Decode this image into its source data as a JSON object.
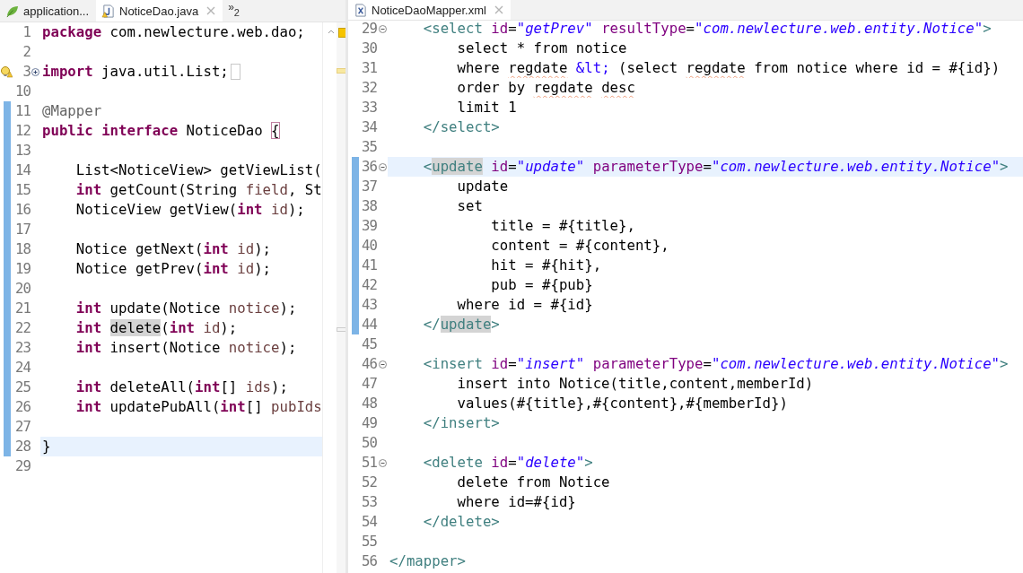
{
  "left_editor": {
    "tabs": [
      {
        "kind": "spring",
        "label": "application...",
        "selected": false,
        "closable": false
      },
      {
        "kind": "java",
        "label": "NoticeDao.java",
        "selected": true,
        "closable": true
      }
    ],
    "overflow": {
      "glyph": "»",
      "count": "2"
    },
    "lines": [
      {
        "number": "1",
        "changed": false,
        "current": false,
        "tokens": [
          {
            "kind": "kw",
            "text": "package"
          },
          {
            "kind": "plain",
            "text": " com.newlecture.web.dao;"
          }
        ]
      },
      {
        "number": "2",
        "changed": false,
        "current": false
      },
      {
        "number": "3",
        "changed": false,
        "current": false,
        "expanded": false,
        "warning": true,
        "folded_marker": true,
        "tokens": [
          {
            "kind": "kw",
            "text": "import"
          },
          {
            "kind": "plain",
            "text": " java.util.List;"
          }
        ]
      },
      {
        "number": "10",
        "changed": false,
        "current": false
      },
      {
        "number": "11",
        "changed": true,
        "current": false,
        "tokens": [
          {
            "kind": "ann",
            "text": "@Mapper"
          }
        ]
      },
      {
        "number": "12",
        "changed": true,
        "current": false,
        "tokens": [
          {
            "kind": "kw",
            "text": "public "
          },
          {
            "kind": "kw",
            "text": "interface"
          },
          {
            "kind": "plain",
            "text": " NoticeDao "
          },
          {
            "kind": "bracket",
            "text": "{"
          }
        ]
      },
      {
        "number": "13",
        "changed": true,
        "current": false
      },
      {
        "number": "14",
        "changed": true,
        "current": false,
        "tokens": [
          {
            "kind": "plain",
            "text": "    List<NoticeView> getViewList("
          }
        ]
      },
      {
        "number": "15",
        "changed": true,
        "current": false,
        "tokens": [
          {
            "kind": "kw",
            "text": "    int"
          },
          {
            "kind": "plain",
            "text": " getCount(String "
          },
          {
            "kind": "param",
            "text": "field"
          },
          {
            "kind": "plain",
            "text": ", St"
          }
        ]
      },
      {
        "number": "16",
        "changed": true,
        "current": false,
        "tokens": [
          {
            "kind": "plain",
            "text": "    NoticeView getView("
          },
          {
            "kind": "kw",
            "text": "int "
          },
          {
            "kind": "param",
            "text": "id"
          },
          {
            "kind": "plain",
            "text": ");"
          }
        ]
      },
      {
        "number": "17",
        "changed": true,
        "current": false
      },
      {
        "number": "18",
        "changed": true,
        "current": false,
        "tokens": [
          {
            "kind": "plain",
            "text": "    Notice getNext("
          },
          {
            "kind": "kw",
            "text": "int "
          },
          {
            "kind": "param",
            "text": "id"
          },
          {
            "kind": "plain",
            "text": ");"
          }
        ]
      },
      {
        "number": "19",
        "changed": true,
        "current": false,
        "tokens": [
          {
            "kind": "plain",
            "text": "    Notice getPrev("
          },
          {
            "kind": "kw",
            "text": "int "
          },
          {
            "kind": "param",
            "text": "id"
          },
          {
            "kind": "plain",
            "text": ");"
          }
        ]
      },
      {
        "number": "20",
        "changed": true,
        "current": false
      },
      {
        "number": "21",
        "changed": true,
        "current": false,
        "tokens": [
          {
            "kind": "kw",
            "text": "    int"
          },
          {
            "kind": "plain",
            "text": " update(Notice "
          },
          {
            "kind": "param",
            "text": "notice"
          },
          {
            "kind": "plain",
            "text": ");"
          }
        ]
      },
      {
        "number": "22",
        "changed": true,
        "current": false,
        "tokens": [
          {
            "kind": "kw",
            "text": "    int "
          },
          {
            "kind": "occurrence",
            "text": "delete"
          },
          {
            "kind": "plain",
            "text": "("
          },
          {
            "kind": "kw",
            "text": "int "
          },
          {
            "kind": "param",
            "text": "id"
          },
          {
            "kind": "plain",
            "text": ");"
          }
        ]
      },
      {
        "number": "23",
        "changed": true,
        "current": false,
        "tokens": [
          {
            "kind": "kw",
            "text": "    int"
          },
          {
            "kind": "plain",
            "text": " insert(Notice "
          },
          {
            "kind": "param",
            "text": "notice"
          },
          {
            "kind": "plain",
            "text": ");"
          }
        ]
      },
      {
        "number": "24",
        "changed": true,
        "current": false
      },
      {
        "number": "25",
        "changed": true,
        "current": false,
        "tokens": [
          {
            "kind": "kw",
            "text": "    int"
          },
          {
            "kind": "plain",
            "text": " deleteAll("
          },
          {
            "kind": "kw",
            "text": "int"
          },
          {
            "kind": "plain",
            "text": "[] "
          },
          {
            "kind": "param",
            "text": "ids"
          },
          {
            "kind": "plain",
            "text": ");"
          }
        ]
      },
      {
        "number": "26",
        "changed": true,
        "current": false,
        "tokens": [
          {
            "kind": "kw",
            "text": "    int"
          },
          {
            "kind": "plain",
            "text": " updatePubAll("
          },
          {
            "kind": "kw",
            "text": "int"
          },
          {
            "kind": "plain",
            "text": "[] "
          },
          {
            "kind": "param",
            "text": "pubIds"
          }
        ]
      },
      {
        "number": "27",
        "changed": true,
        "current": false
      },
      {
        "number": "28",
        "changed": true,
        "current": true,
        "tokens": [
          {
            "kind": "plain",
            "text": "}"
          }
        ]
      },
      {
        "number": "29",
        "changed": false,
        "current": false
      }
    ]
  },
  "right_editor": {
    "tabs": [
      {
        "kind": "xml",
        "label": "NoticeDaoMapper.xml",
        "selected": true,
        "closable": true
      }
    ],
    "lines": [
      {
        "number": "29",
        "changed": false,
        "current": false,
        "expanded": true,
        "tokens": [
          {
            "kind": "tag",
            "text": "    <select "
          },
          {
            "kind": "attr",
            "text": "id"
          },
          {
            "kind": "plain",
            "text": "="
          },
          {
            "kind": "str",
            "text": "\"getPrev\" "
          },
          {
            "kind": "attr",
            "text": "resultType"
          },
          {
            "kind": "plain",
            "text": "="
          },
          {
            "kind": "str",
            "text": "\"com.newlecture.web.entity.Notice\""
          },
          {
            "kind": "tag",
            "text": ">"
          }
        ]
      },
      {
        "number": "30",
        "changed": false,
        "current": false,
        "tokens": [
          {
            "kind": "plain",
            "text": "        select * from notice"
          }
        ]
      },
      {
        "number": "31",
        "changed": false,
        "current": false,
        "tokens": [
          {
            "kind": "plain",
            "text": "        where "
          },
          {
            "kind": "flagged",
            "text": "regdate"
          },
          {
            "kind": "ent",
            "text": " &lt;"
          },
          {
            "kind": "plain",
            "text": " (select "
          },
          {
            "kind": "flagged",
            "text": "regdate"
          },
          {
            "kind": "plain",
            "text": " from notice where id = #{id})"
          }
        ]
      },
      {
        "number": "32",
        "changed": false,
        "current": false,
        "tokens": [
          {
            "kind": "plain",
            "text": "        order by "
          },
          {
            "kind": "flagged",
            "text": "regdate"
          },
          {
            "kind": "flagged",
            "text": " desc"
          }
        ]
      },
      {
        "number": "33",
        "changed": false,
        "current": false,
        "tokens": [
          {
            "kind": "plain",
            "text": "        limit 1"
          }
        ]
      },
      {
        "number": "34",
        "changed": false,
        "current": false,
        "tokens": [
          {
            "kind": "tag",
            "text": "    </select>"
          }
        ]
      },
      {
        "number": "35",
        "changed": false,
        "current": false
      },
      {
        "number": "36",
        "changed": true,
        "current": true,
        "expanded": true,
        "tokens": [
          {
            "kind": "tag",
            "text": "    <"
          },
          {
            "kind": "tagmatch",
            "text": "update"
          },
          {
            "kind": "attr",
            "text": " id"
          },
          {
            "kind": "plain",
            "text": "="
          },
          {
            "kind": "str",
            "text": "\"update\" "
          },
          {
            "kind": "attr",
            "text": "parameterType"
          },
          {
            "kind": "plain",
            "text": "="
          },
          {
            "kind": "str",
            "text": "\"com.newlecture.web.entity.Notice\""
          },
          {
            "kind": "tag",
            "text": ">"
          }
        ]
      },
      {
        "number": "37",
        "changed": true,
        "current": false,
        "tokens": [
          {
            "kind": "plain",
            "text": "        update"
          }
        ]
      },
      {
        "number": "38",
        "changed": true,
        "current": false,
        "tokens": [
          {
            "kind": "plain",
            "text": "        set"
          }
        ]
      },
      {
        "number": "39",
        "changed": true,
        "current": false,
        "tokens": [
          {
            "kind": "plain",
            "text": "            title = #{title},"
          }
        ]
      },
      {
        "number": "40",
        "changed": true,
        "current": false,
        "tokens": [
          {
            "kind": "plain",
            "text": "            content = #{content},"
          }
        ]
      },
      {
        "number": "41",
        "changed": true,
        "current": false,
        "tokens": [
          {
            "kind": "plain",
            "text": "            hit = #{hit},"
          }
        ]
      },
      {
        "number": "42",
        "changed": true,
        "current": false,
        "tokens": [
          {
            "kind": "plain",
            "text": "            pub = #{pub}"
          }
        ]
      },
      {
        "number": "43",
        "changed": true,
        "current": false,
        "tokens": [
          {
            "kind": "plain",
            "text": "        where id = #{id}"
          }
        ]
      },
      {
        "number": "44",
        "changed": true,
        "current": false,
        "tokens": [
          {
            "kind": "tag",
            "text": "    </"
          },
          {
            "kind": "tagmatch",
            "text": "update"
          },
          {
            "kind": "tag",
            "text": ">"
          }
        ]
      },
      {
        "number": "45",
        "changed": false,
        "current": false
      },
      {
        "number": "46",
        "changed": false,
        "current": false,
        "expanded": true,
        "tokens": [
          {
            "kind": "tag",
            "text": "    <insert "
          },
          {
            "kind": "attr",
            "text": "id"
          },
          {
            "kind": "plain",
            "text": "="
          },
          {
            "kind": "str",
            "text": "\"insert\" "
          },
          {
            "kind": "attr",
            "text": "parameterType"
          },
          {
            "kind": "plain",
            "text": "="
          },
          {
            "kind": "str",
            "text": "\"com.newlecture.web.entity.Notice\""
          },
          {
            "kind": "tag",
            "text": ">"
          }
        ]
      },
      {
        "number": "47",
        "changed": false,
        "current": false,
        "tokens": [
          {
            "kind": "plain",
            "text": "        insert into Notice(title,content,memberId)"
          }
        ]
      },
      {
        "number": "48",
        "changed": false,
        "current": false,
        "tokens": [
          {
            "kind": "plain",
            "text": "        values(#{title},#{content},#{memberId})"
          }
        ]
      },
      {
        "number": "49",
        "changed": false,
        "current": false,
        "tokens": [
          {
            "kind": "tag",
            "text": "    </insert>"
          }
        ]
      },
      {
        "number": "50",
        "changed": false,
        "current": false
      },
      {
        "number": "51",
        "changed": false,
        "current": false,
        "expanded": true,
        "tokens": [
          {
            "kind": "tag",
            "text": "    <delete "
          },
          {
            "kind": "attr",
            "text": "id"
          },
          {
            "kind": "plain",
            "text": "="
          },
          {
            "kind": "str",
            "text": "\"delete\""
          },
          {
            "kind": "tag",
            "text": ">"
          }
        ]
      },
      {
        "number": "52",
        "changed": false,
        "current": false,
        "tokens": [
          {
            "kind": "plain",
            "text": "        delete from Notice"
          }
        ]
      },
      {
        "number": "53",
        "changed": false,
        "current": false,
        "tokens": [
          {
            "kind": "plain",
            "text": "        where id=#{id}"
          }
        ]
      },
      {
        "number": "54",
        "changed": false,
        "current": false,
        "tokens": [
          {
            "kind": "tag",
            "text": "    </delete>"
          }
        ]
      },
      {
        "number": "55",
        "changed": false,
        "current": false
      },
      {
        "number": "56",
        "changed": false,
        "current": false,
        "tokens": [
          {
            "kind": "tag",
            "text": "</mapper>"
          }
        ]
      }
    ]
  }
}
